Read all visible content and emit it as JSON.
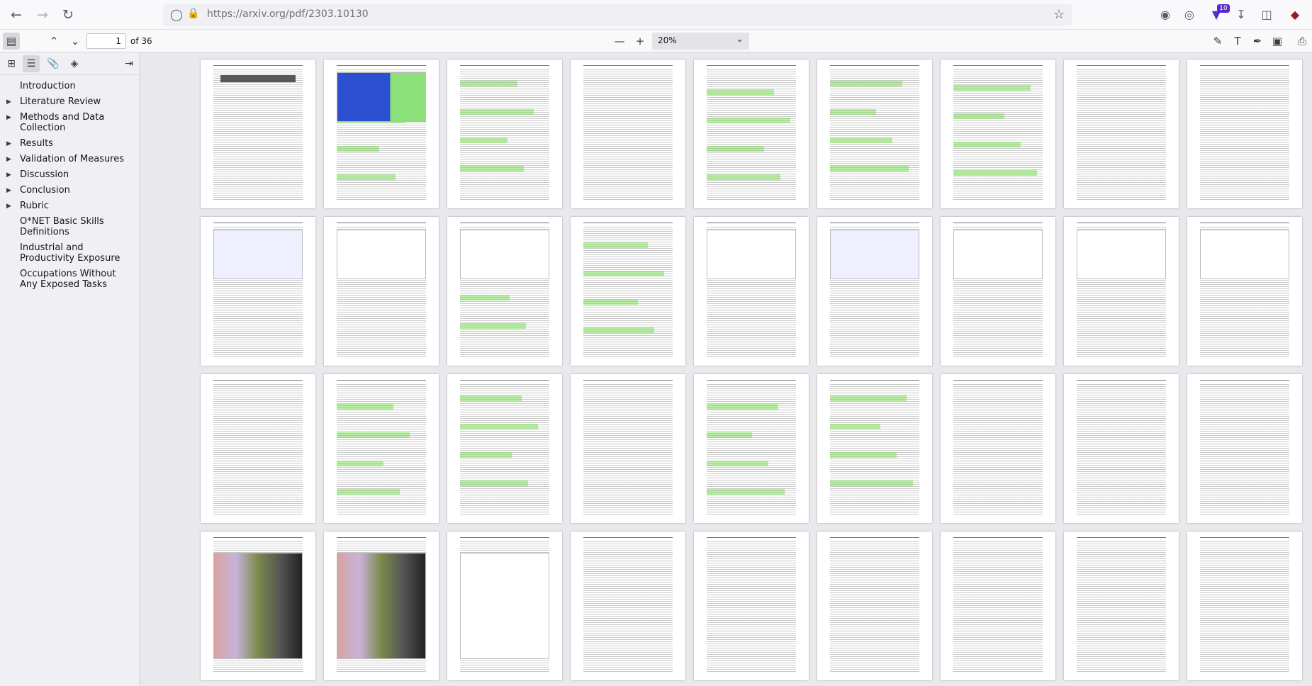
{
  "browser": {
    "url": "https://arxiv.org/pdf/2303.10130",
    "extension_badge": "10"
  },
  "pdf_toolbar": {
    "page_number": "1",
    "page_count": "of 36",
    "zoom": "20%"
  },
  "outline": [
    {
      "label": "Introduction",
      "expandable": false
    },
    {
      "label": "Literature Review",
      "expandable": true
    },
    {
      "label": "Methods and Data Collection",
      "expandable": true
    },
    {
      "label": "Results",
      "expandable": true
    },
    {
      "label": "Validation of Measures",
      "expandable": true
    },
    {
      "label": "Discussion",
      "expandable": true
    },
    {
      "label": "Conclusion",
      "expandable": true
    },
    {
      "label": "Rubric",
      "expandable": true
    },
    {
      "label": "O*NET Basic Skills Definitions",
      "expandable": false
    },
    {
      "label": "Industrial and Productivity Exposure",
      "expandable": false
    },
    {
      "label": "Occupations Without Any Exposed Tasks",
      "expandable": false
    }
  ],
  "icons": {
    "back": "back-arrow-icon",
    "forward": "forward-arrow-icon",
    "reload": "reload-icon",
    "shield": "shield-icon",
    "lock": "lock-icon",
    "bookmark": "star-icon"
  },
  "colors": {
    "highlight": "#7be05a",
    "badge": "#592acb"
  }
}
